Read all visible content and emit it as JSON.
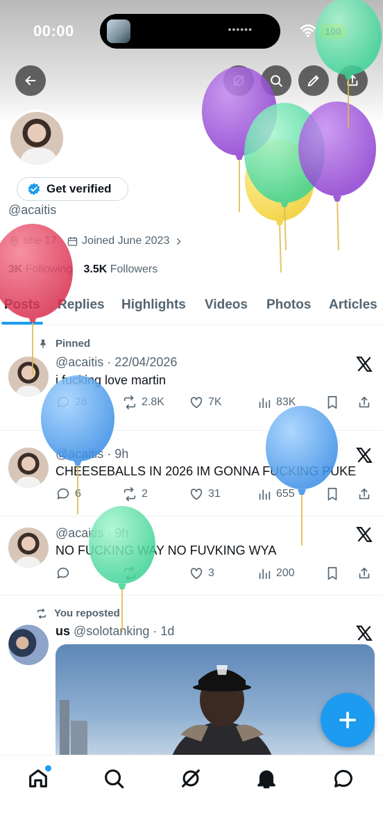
{
  "status": {
    "time": "00:00",
    "battery": "100"
  },
  "profile": {
    "handle": "@acaitis",
    "verified_label": "Get verified",
    "bio_location": "she 17",
    "joined": "Joined June 2023",
    "following_count": "3K",
    "following_label": "Following",
    "followers_count": "3.5K",
    "followers_label": "Followers"
  },
  "tabs": [
    "Posts",
    "Replies",
    "Highlights",
    "Videos",
    "Photos",
    "Articles"
  ],
  "posts": [
    {
      "context": "Pinned",
      "handle": "@acaitis",
      "date": "· 22/04/2026",
      "text": "i fucking love martin",
      "replies": "26",
      "reposts": "2.8K",
      "likes": "7K",
      "views": "83K"
    },
    {
      "handle": "@acaitis",
      "date": "· 9h",
      "text": "CHEESEBALLS IN 2026 IM GONNA FUCKING PUKE",
      "replies": "6",
      "reposts": "2",
      "likes": "31",
      "views": "655"
    },
    {
      "handle": "@acaitis",
      "date": "· 9h",
      "text": "NO FUCKING WAY NO FUVKING WYA",
      "replies": "",
      "reposts": "",
      "likes": "3",
      "views": "200"
    },
    {
      "context": "You reposted",
      "name": "us",
      "handle": "@solotanking",
      "date": "· 1d"
    }
  ],
  "colors": {
    "accent": "#1d9bf0",
    "text": "#0f1419",
    "muted": "#536471"
  },
  "icons": [
    "back-icon",
    "search-icon",
    "pen-icon",
    "share-icon",
    "verified-badge-icon",
    "calendar-icon",
    "pin-icon",
    "repost-icon",
    "x-logo-icon",
    "home-icon",
    "grok-icon",
    "bell-icon",
    "messages-icon",
    "plus-icon"
  ]
}
